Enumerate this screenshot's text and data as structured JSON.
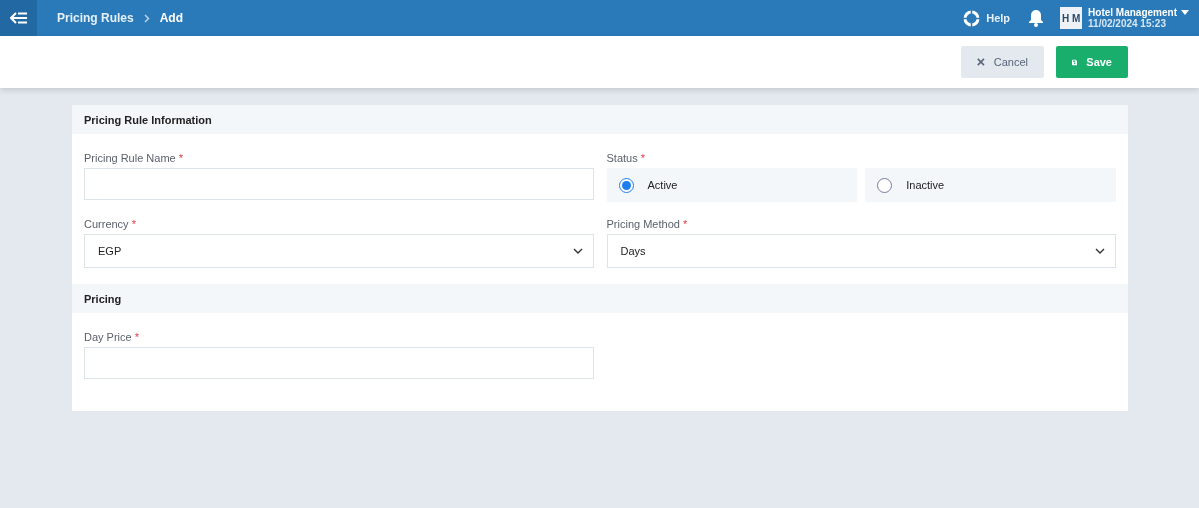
{
  "header": {
    "breadcrumbs": [
      "Pricing Rules",
      "Add"
    ],
    "help": "Help",
    "user_initials": "H M",
    "user_name": "Hotel Management",
    "datetime": "11/02/2024 15:23"
  },
  "toolbar": {
    "buttons": [
      {
        "label": "Cancel",
        "kind": "cancel"
      },
      {
        "label": "Save",
        "kind": "save"
      }
    ]
  },
  "sections": [
    {
      "title": "Pricing Rule Information",
      "fields": [
        {
          "kind": "text",
          "label": "Pricing Rule Name",
          "required_mark": "*"
        },
        {
          "kind": "radio",
          "label": "Status",
          "required_mark": "*",
          "options": [
            {
              "label": "Active",
              "selected": true
            },
            {
              "label": "Inactive",
              "selected": false
            }
          ]
        },
        {
          "kind": "select",
          "label": "Currency",
          "required_mark": "*",
          "value": "EGP"
        },
        {
          "kind": "select",
          "label": "Pricing Method",
          "required_mark": "*",
          "value": "Days"
        }
      ]
    },
    {
      "title": "Pricing",
      "fields": [
        {
          "kind": "text",
          "label": "Day Price",
          "required_mark": "*"
        }
      ]
    }
  ]
}
